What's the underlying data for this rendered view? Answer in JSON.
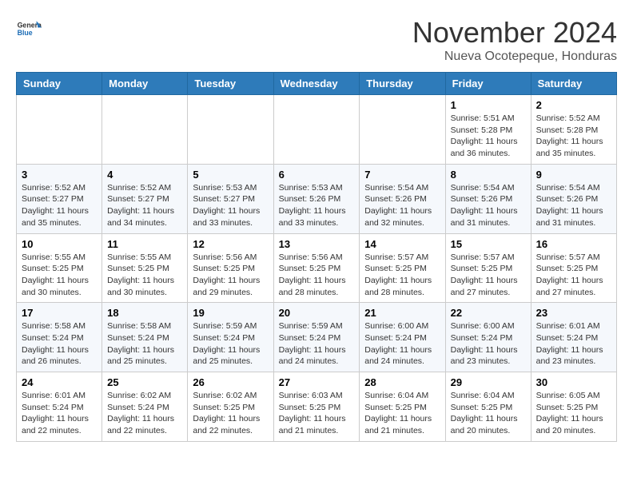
{
  "header": {
    "logo_general": "General",
    "logo_blue": "Blue",
    "month_title": "November 2024",
    "location": "Nueva Ocotepeque, Honduras"
  },
  "calendar": {
    "days_of_week": [
      "Sunday",
      "Monday",
      "Tuesday",
      "Wednesday",
      "Thursday",
      "Friday",
      "Saturday"
    ],
    "weeks": [
      [
        {
          "day": "",
          "info": ""
        },
        {
          "day": "",
          "info": ""
        },
        {
          "day": "",
          "info": ""
        },
        {
          "day": "",
          "info": ""
        },
        {
          "day": "",
          "info": ""
        },
        {
          "day": "1",
          "info": "Sunrise: 5:51 AM\nSunset: 5:28 PM\nDaylight: 11 hours and 36 minutes."
        },
        {
          "day": "2",
          "info": "Sunrise: 5:52 AM\nSunset: 5:28 PM\nDaylight: 11 hours and 35 minutes."
        }
      ],
      [
        {
          "day": "3",
          "info": "Sunrise: 5:52 AM\nSunset: 5:27 PM\nDaylight: 11 hours and 35 minutes."
        },
        {
          "day": "4",
          "info": "Sunrise: 5:52 AM\nSunset: 5:27 PM\nDaylight: 11 hours and 34 minutes."
        },
        {
          "day": "5",
          "info": "Sunrise: 5:53 AM\nSunset: 5:27 PM\nDaylight: 11 hours and 33 minutes."
        },
        {
          "day": "6",
          "info": "Sunrise: 5:53 AM\nSunset: 5:26 PM\nDaylight: 11 hours and 33 minutes."
        },
        {
          "day": "7",
          "info": "Sunrise: 5:54 AM\nSunset: 5:26 PM\nDaylight: 11 hours and 32 minutes."
        },
        {
          "day": "8",
          "info": "Sunrise: 5:54 AM\nSunset: 5:26 PM\nDaylight: 11 hours and 31 minutes."
        },
        {
          "day": "9",
          "info": "Sunrise: 5:54 AM\nSunset: 5:26 PM\nDaylight: 11 hours and 31 minutes."
        }
      ],
      [
        {
          "day": "10",
          "info": "Sunrise: 5:55 AM\nSunset: 5:25 PM\nDaylight: 11 hours and 30 minutes."
        },
        {
          "day": "11",
          "info": "Sunrise: 5:55 AM\nSunset: 5:25 PM\nDaylight: 11 hours and 30 minutes."
        },
        {
          "day": "12",
          "info": "Sunrise: 5:56 AM\nSunset: 5:25 PM\nDaylight: 11 hours and 29 minutes."
        },
        {
          "day": "13",
          "info": "Sunrise: 5:56 AM\nSunset: 5:25 PM\nDaylight: 11 hours and 28 minutes."
        },
        {
          "day": "14",
          "info": "Sunrise: 5:57 AM\nSunset: 5:25 PM\nDaylight: 11 hours and 28 minutes."
        },
        {
          "day": "15",
          "info": "Sunrise: 5:57 AM\nSunset: 5:25 PM\nDaylight: 11 hours and 27 minutes."
        },
        {
          "day": "16",
          "info": "Sunrise: 5:57 AM\nSunset: 5:25 PM\nDaylight: 11 hours and 27 minutes."
        }
      ],
      [
        {
          "day": "17",
          "info": "Sunrise: 5:58 AM\nSunset: 5:24 PM\nDaylight: 11 hours and 26 minutes."
        },
        {
          "day": "18",
          "info": "Sunrise: 5:58 AM\nSunset: 5:24 PM\nDaylight: 11 hours and 25 minutes."
        },
        {
          "day": "19",
          "info": "Sunrise: 5:59 AM\nSunset: 5:24 PM\nDaylight: 11 hours and 25 minutes."
        },
        {
          "day": "20",
          "info": "Sunrise: 5:59 AM\nSunset: 5:24 PM\nDaylight: 11 hours and 24 minutes."
        },
        {
          "day": "21",
          "info": "Sunrise: 6:00 AM\nSunset: 5:24 PM\nDaylight: 11 hours and 24 minutes."
        },
        {
          "day": "22",
          "info": "Sunrise: 6:00 AM\nSunset: 5:24 PM\nDaylight: 11 hours and 23 minutes."
        },
        {
          "day": "23",
          "info": "Sunrise: 6:01 AM\nSunset: 5:24 PM\nDaylight: 11 hours and 23 minutes."
        }
      ],
      [
        {
          "day": "24",
          "info": "Sunrise: 6:01 AM\nSunset: 5:24 PM\nDaylight: 11 hours and 22 minutes."
        },
        {
          "day": "25",
          "info": "Sunrise: 6:02 AM\nSunset: 5:24 PM\nDaylight: 11 hours and 22 minutes."
        },
        {
          "day": "26",
          "info": "Sunrise: 6:02 AM\nSunset: 5:25 PM\nDaylight: 11 hours and 22 minutes."
        },
        {
          "day": "27",
          "info": "Sunrise: 6:03 AM\nSunset: 5:25 PM\nDaylight: 11 hours and 21 minutes."
        },
        {
          "day": "28",
          "info": "Sunrise: 6:04 AM\nSunset: 5:25 PM\nDaylight: 11 hours and 21 minutes."
        },
        {
          "day": "29",
          "info": "Sunrise: 6:04 AM\nSunset: 5:25 PM\nDaylight: 11 hours and 20 minutes."
        },
        {
          "day": "30",
          "info": "Sunrise: 6:05 AM\nSunset: 5:25 PM\nDaylight: 11 hours and 20 minutes."
        }
      ]
    ]
  }
}
